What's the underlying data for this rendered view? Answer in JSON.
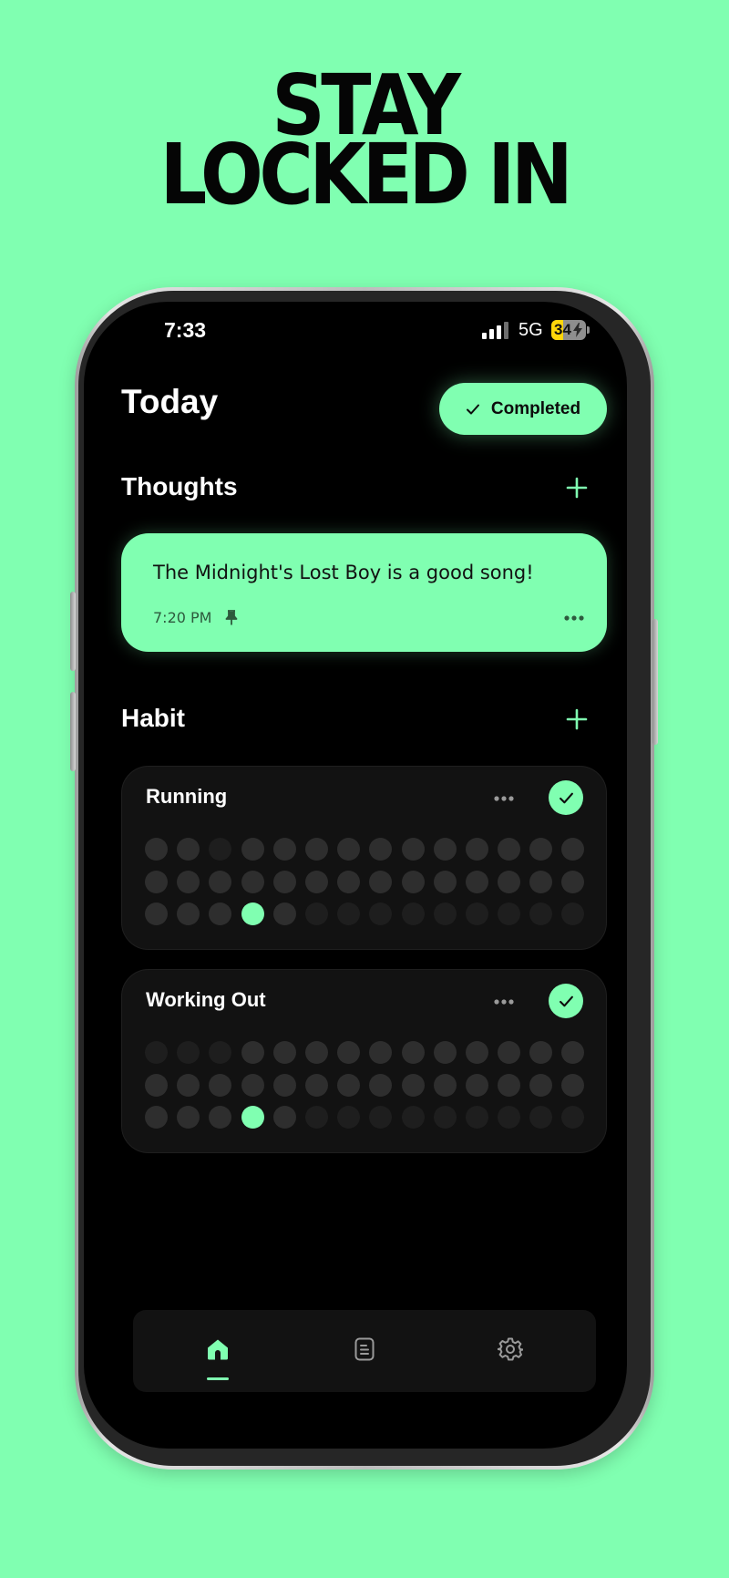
{
  "promo": {
    "headline_line1": "STAY",
    "headline_line2": "LOCKED IN"
  },
  "status_bar": {
    "time": "7:33",
    "network": "5G",
    "battery": "34",
    "battery_fraction": 0.34,
    "charging": true
  },
  "header": {
    "title": "Today",
    "completed_label": "Completed",
    "completed_icon": "check-icon"
  },
  "thoughts": {
    "title": "Thoughts",
    "add_icon": "plus-icon",
    "items": [
      {
        "text": "The Midnight's Lost Boy is a good song!",
        "time": "7:20 PM",
        "pinned": true,
        "pin_icon": "pin-icon",
        "menu_icon": "more-horizontal-icon"
      }
    ]
  },
  "habits": {
    "title": "Habit",
    "add_icon": "plus-icon",
    "items": [
      {
        "name": "Running",
        "completed": true,
        "menu_icon": "more-horizontal-icon",
        "grid": {
          "rows": 3,
          "columns": 14,
          "dim_cells": [
            [
              0,
              2
            ],
            [
              2,
              5
            ],
            [
              2,
              6
            ],
            [
              2,
              7
            ],
            [
              2,
              8
            ],
            [
              2,
              9
            ],
            [
              2,
              10
            ],
            [
              2,
              11
            ],
            [
              2,
              12
            ],
            [
              2,
              13
            ]
          ],
          "active_cells": [
            [
              2,
              3
            ]
          ]
        }
      },
      {
        "name": "Working Out",
        "completed": true,
        "menu_icon": "more-horizontal-icon",
        "grid": {
          "rows": 3,
          "columns": 14,
          "dim_cells": [
            [
              0,
              0
            ],
            [
              0,
              1
            ],
            [
              0,
              2
            ],
            [
              2,
              5
            ],
            [
              2,
              6
            ],
            [
              2,
              7
            ],
            [
              2,
              8
            ],
            [
              2,
              9
            ],
            [
              2,
              10
            ],
            [
              2,
              11
            ],
            [
              2,
              12
            ],
            [
              2,
              13
            ]
          ],
          "active_cells": [
            [
              2,
              3
            ]
          ]
        }
      }
    ]
  },
  "bottom_nav": {
    "items": [
      {
        "icon": "home-icon",
        "active": true
      },
      {
        "icon": "notes-icon",
        "active": false
      },
      {
        "icon": "gear-icon",
        "active": false
      }
    ]
  },
  "colors": {
    "accent": "#80FFB1",
    "background": "#000000",
    "card": "#121212",
    "dot_inactive": "#2E2E2E",
    "dot_dim": "#1E1E1E"
  }
}
